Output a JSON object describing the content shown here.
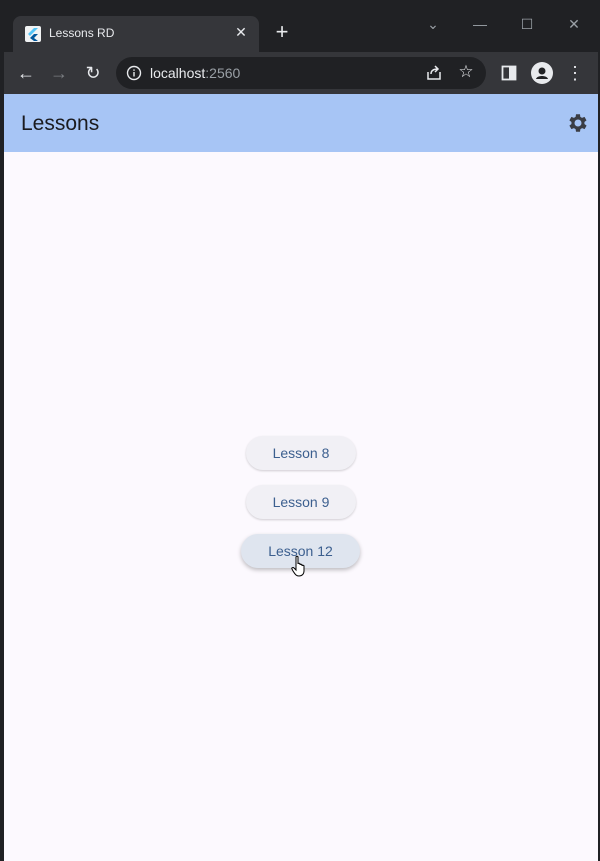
{
  "browser": {
    "tab_title": "Lessons RD",
    "url_host": "localhost",
    "url_port": ":2560"
  },
  "app": {
    "title": "Lessons",
    "buttons": [
      {
        "label": "Lesson 8"
      },
      {
        "label": "Lesson 9"
      },
      {
        "label": "Lesson 12"
      }
    ]
  },
  "colors": {
    "appbar": "#a7c5f5",
    "button_text": "#3c5f8f",
    "page_bg": "#fcf9fe"
  }
}
